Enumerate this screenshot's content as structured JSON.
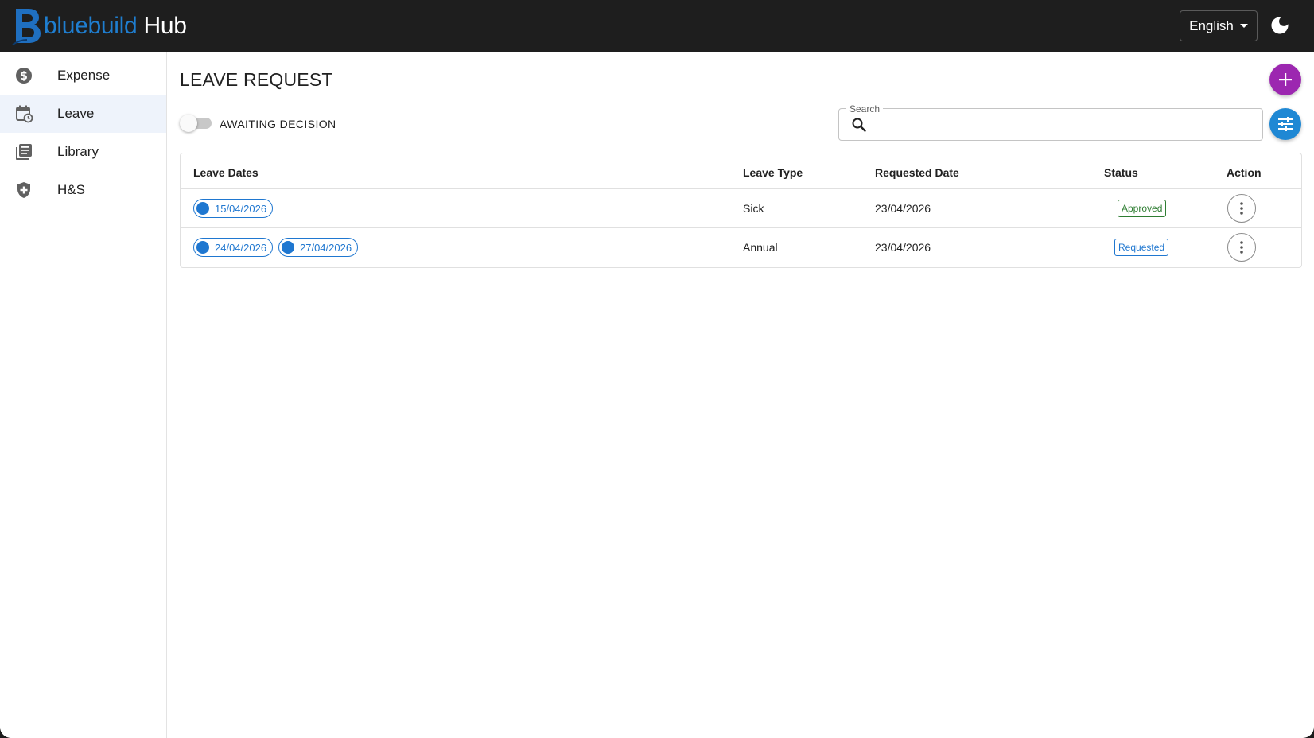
{
  "app": {
    "brand_part1": "bluebuild",
    "brand_part2": "Hub"
  },
  "header": {
    "language": "English"
  },
  "sidebar": {
    "items": [
      {
        "label": "Expense",
        "icon": "dollar-circle-icon"
      },
      {
        "label": "Leave",
        "icon": "calendar-clock-icon",
        "active": true
      },
      {
        "label": "Library",
        "icon": "library-books-icon"
      },
      {
        "label": "H&S",
        "icon": "shield-plus-icon"
      }
    ]
  },
  "main": {
    "title": "LEAVE REQUEST",
    "toggle_label": "AWAITING DECISION",
    "toggle_on": false,
    "search": {
      "label": "Search",
      "value": "",
      "placeholder": ""
    }
  },
  "table": {
    "headers": {
      "dates": "Leave Dates",
      "type": "Leave Type",
      "requested": "Requested Date",
      "status": "Status",
      "action": "Action"
    },
    "rows": [
      {
        "dates": [
          "15/04/2026"
        ],
        "type": "Sick",
        "requested": "23/04/2026",
        "status": "Approved"
      },
      {
        "dates": [
          "24/04/2026",
          "27/04/2026"
        ],
        "type": "Annual",
        "requested": "23/04/2026",
        "status": "Requested"
      }
    ]
  },
  "colors": {
    "topbar": "#1e1e1e",
    "brand_blue": "#1f7ed0",
    "add_fab": "#9c27b0",
    "filter_fab": "#1f88d4",
    "approved": "#2e7d32",
    "requested": "#1f77d0"
  }
}
